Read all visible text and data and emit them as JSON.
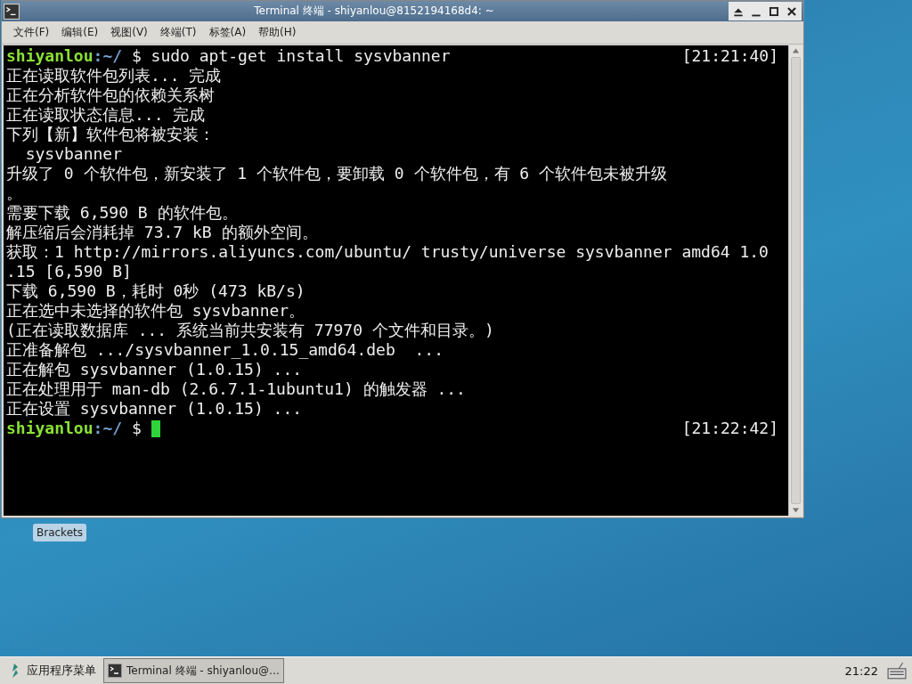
{
  "window": {
    "title": "Terminal 终端 - shiyanlou@8152194168d4: ~"
  },
  "menu": [
    {
      "label": "文件(F)"
    },
    {
      "label": "编辑(E)"
    },
    {
      "label": "视图(V)"
    },
    {
      "label": "终端(T)"
    },
    {
      "label": "标签(A)"
    },
    {
      "label": "帮助(H)"
    }
  ],
  "terminal": {
    "lines": [
      {
        "kind": "prompt",
        "user": "shiyanlou",
        "path": ":~/",
        "command": " $ sudo apt-get install sysvbanner",
        "time": "[21:21:40]",
        "cursor": false
      },
      {
        "kind": "output",
        "text": "正在读取软件包列表... 完成"
      },
      {
        "kind": "output",
        "text": "正在分析软件包的依赖关系树"
      },
      {
        "kind": "output",
        "text": "正在读取状态信息... 完成"
      },
      {
        "kind": "output",
        "text": "下列【新】软件包将被安装："
      },
      {
        "kind": "output",
        "text": "  sysvbanner"
      },
      {
        "kind": "output",
        "text": "升级了 0 个软件包，新安装了 1 个软件包，要卸载 0 个软件包，有 6 个软件包未被升级"
      },
      {
        "kind": "output",
        "text": "。"
      },
      {
        "kind": "output",
        "text": "需要下载 6,590 B 的软件包。"
      },
      {
        "kind": "output",
        "text": "解压缩后会消耗掉 73.7 kB 的额外空间。"
      },
      {
        "kind": "output",
        "text": "获取：1 http://mirrors.aliyuncs.com/ubuntu/ trusty/universe sysvbanner amd64 1.0"
      },
      {
        "kind": "output",
        "text": ".15 [6,590 B]"
      },
      {
        "kind": "output",
        "text": "下载 6,590 B，耗时 0秒 (473 kB/s)"
      },
      {
        "kind": "output",
        "text": "正在选中未选择的软件包 sysvbanner。"
      },
      {
        "kind": "output",
        "text": "(正在读取数据库 ... 系统当前共安装有 77970 个文件和目录。)"
      },
      {
        "kind": "output",
        "text": "正准备解包 .../sysvbanner_1.0.15_amd64.deb  ..."
      },
      {
        "kind": "output",
        "text": "正在解包 sysvbanner (1.0.15) ..."
      },
      {
        "kind": "output",
        "text": "正在处理用于 man-db (2.6.7.1-1ubuntu1) 的触发器 ..."
      },
      {
        "kind": "output",
        "text": "正在设置 sysvbanner (1.0.15) ..."
      },
      {
        "kind": "prompt",
        "user": "shiyanlou",
        "path": ":~/",
        "command": " $ ",
        "time": "[21:22:42]",
        "cursor": true
      }
    ]
  },
  "desktop": {
    "icons": [
      {
        "label": "Brackets"
      }
    ]
  },
  "taskbar": {
    "menu_label": "应用程序菜单",
    "tasks": [
      {
        "label": "Terminal 终端 - shiyanlou@…",
        "selected": true
      }
    ],
    "clock": "21:22"
  }
}
